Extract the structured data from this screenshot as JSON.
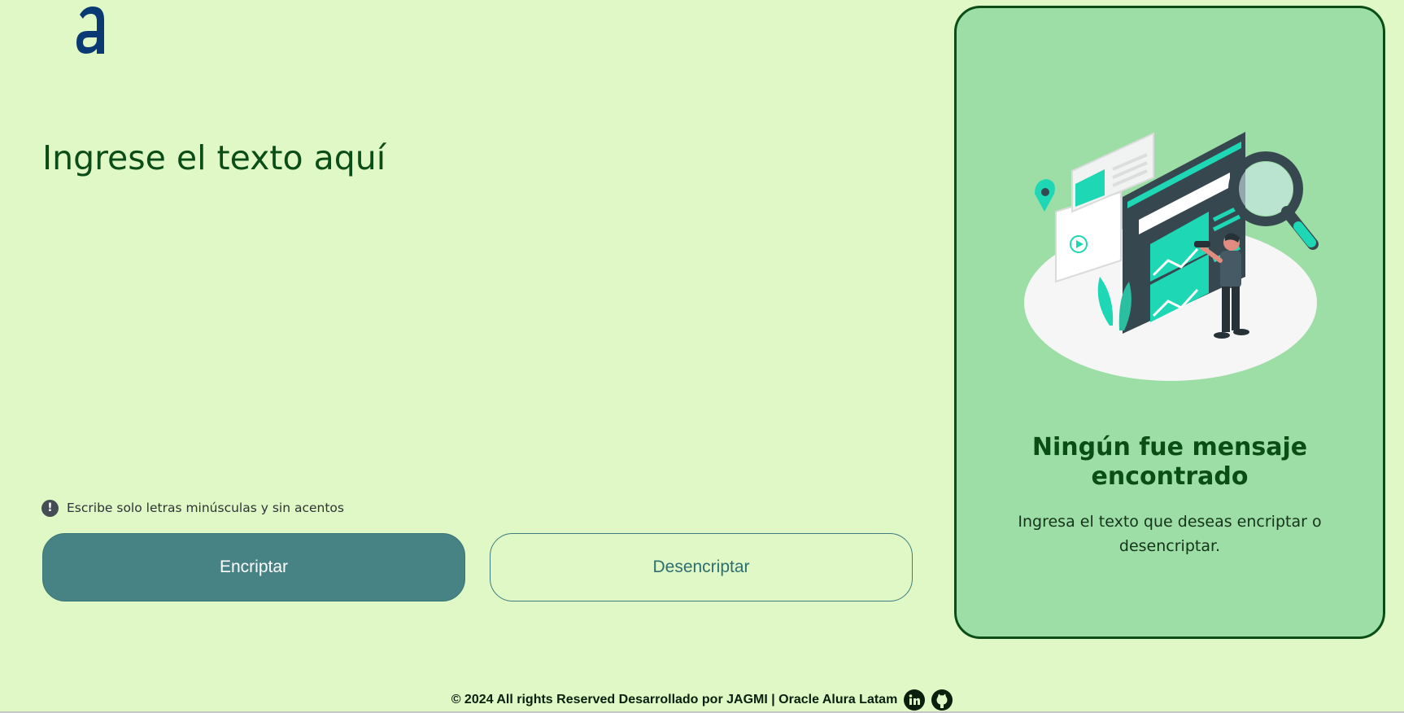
{
  "app": {
    "logo_letter": "a",
    "brand_color": "#0a3a74"
  },
  "input": {
    "placeholder": "Ingrese el texto aquí",
    "value": ""
  },
  "hint": {
    "icon": "exclamation-circle-icon",
    "icon_glyph": "!",
    "text": "Escribe solo letras minúsculas y sin acentos"
  },
  "buttons": {
    "encrypt_label": "Encriptar",
    "decrypt_label": "Desencriptar"
  },
  "output": {
    "illustration": "search-illustration",
    "title": "Ningún fue mensaje encontrado",
    "text": "Ingresa el texto que deseas encriptar o desencriptar."
  },
  "footer": {
    "text": "© 2024 All rights Reserved Desarrollado por JAGMI | Oracle Alura Latam",
    "links": [
      {
        "icon": "linkedin-icon"
      },
      {
        "icon": "github-icon"
      }
    ]
  },
  "colors": {
    "background": "#dff8c5",
    "primary": "#478385",
    "card_bg": "#9ddda6",
    "dark_green": "#0b4d16",
    "accent_teal": "#1ed7b5"
  }
}
